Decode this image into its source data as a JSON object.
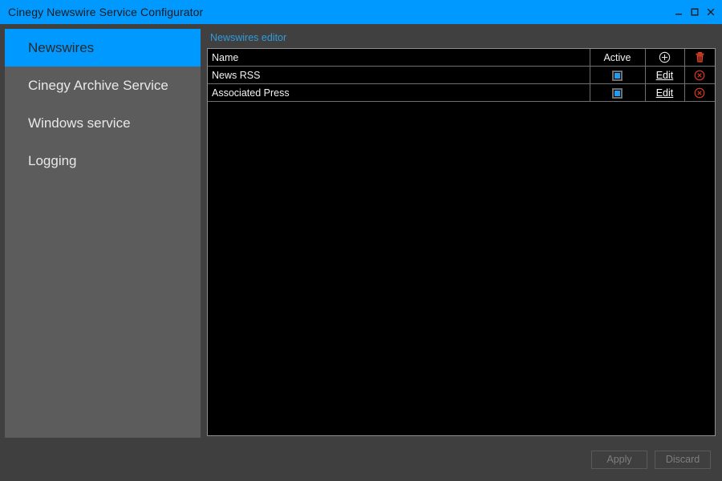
{
  "window": {
    "title": "Cinegy Newswire Service Configurator",
    "version": "",
    "accent_color": "#0099ff",
    "sidebar_color": "#5c5c5c",
    "panel_color": "#404040",
    "grid_background": "#000000",
    "danger_color": "#e03b2a",
    "controls": [
      {
        "name": "minimize-button",
        "glyph": "minimize"
      },
      {
        "name": "maximize-button",
        "glyph": "maximize"
      },
      {
        "name": "close-button",
        "glyph": "close"
      }
    ]
  },
  "sidebar": {
    "items": [
      {
        "label": "Newswires",
        "selected": true
      },
      {
        "label": "Cinegy Archive Service",
        "selected": false
      },
      {
        "label": "Windows service",
        "selected": false
      },
      {
        "label": "Logging",
        "selected": false
      }
    ]
  },
  "editor": {
    "title": "Newswires editor",
    "table": {
      "columns": [
        {
          "key": "name",
          "label": "Name"
        },
        {
          "key": "active",
          "label": "Active"
        },
        {
          "key": "add",
          "label": "",
          "icon": "add-circle-icon"
        },
        {
          "key": "delete",
          "label": "",
          "icon": "trash-icon"
        }
      ],
      "rows": [
        {
          "name": "News RSS",
          "active": true,
          "edit_label": "Edit",
          "delete_icon": "delete-circle-icon"
        },
        {
          "name": "Associated Press",
          "active": true,
          "edit_label": "Edit",
          "delete_icon": "delete-circle-icon"
        }
      ]
    }
  },
  "footer": {
    "apply_label": "Apply",
    "discard_label": "Discard",
    "apply_enabled": false,
    "discard_enabled": false
  }
}
